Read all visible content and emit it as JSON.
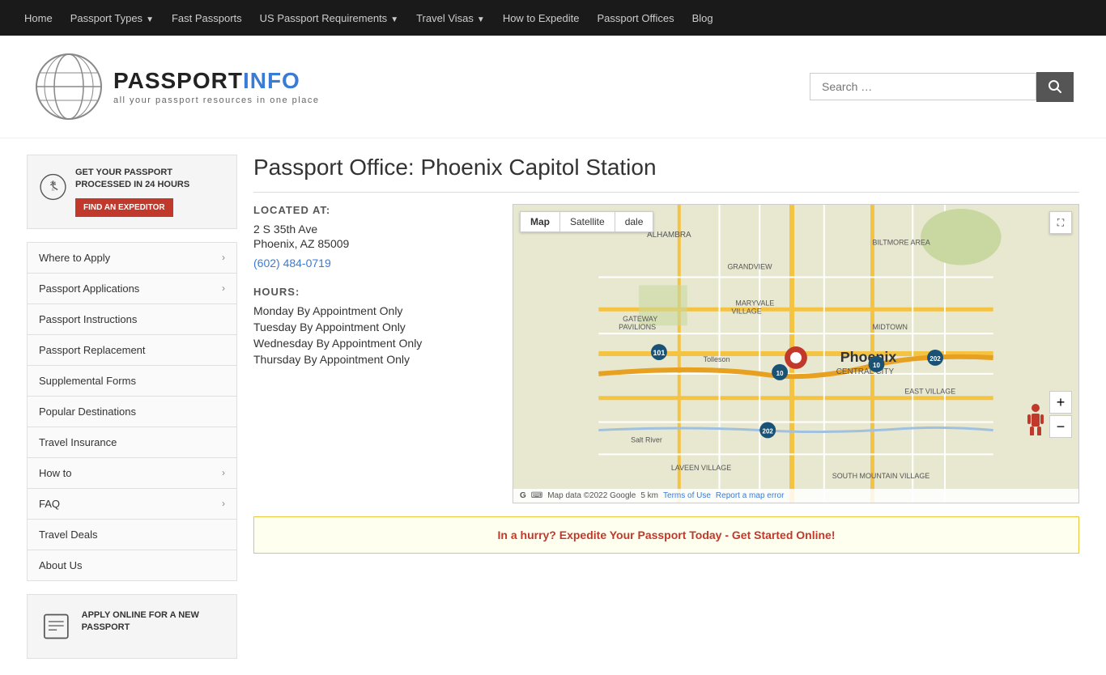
{
  "nav": {
    "items": [
      {
        "label": "Home",
        "hasDropdown": false
      },
      {
        "label": "Passport Types",
        "hasDropdown": true
      },
      {
        "label": "Fast Passports",
        "hasDropdown": false
      },
      {
        "label": "US Passport Requirements",
        "hasDropdown": true
      },
      {
        "label": "Travel Visas",
        "hasDropdown": true
      },
      {
        "label": "How to Expedite",
        "hasDropdown": false
      },
      {
        "label": "Passport Offices",
        "hasDropdown": false
      },
      {
        "label": "Blog",
        "hasDropdown": false
      }
    ]
  },
  "header": {
    "logo_title_plain": "PASSPORT",
    "logo_title_colored": "INFO",
    "logo_subtitle": "all your passport resources in one place",
    "search_placeholder": "Search …"
  },
  "sidebar": {
    "promo1": {
      "icon_label": "24h clock icon",
      "heading": "GET YOUR PASSPORT PROCESSED IN 24 HOURS",
      "button_label": "FIND AN EXPEDITOR"
    },
    "nav_items": [
      {
        "label": "Where to Apply",
        "hasDropdown": true
      },
      {
        "label": "Passport Applications",
        "hasDropdown": true
      },
      {
        "label": "Passport Instructions",
        "hasDropdown": false
      },
      {
        "label": "Passport Replacement",
        "hasDropdown": false
      },
      {
        "label": "Supplemental Forms",
        "hasDropdown": false
      },
      {
        "label": "Popular Destinations",
        "hasDropdown": false
      },
      {
        "label": "Travel Insurance",
        "hasDropdown": false
      },
      {
        "label": "How to",
        "hasDropdown": true
      },
      {
        "label": "FAQ",
        "hasDropdown": true
      },
      {
        "label": "Travel Deals",
        "hasDropdown": false
      },
      {
        "label": "About Us",
        "hasDropdown": false
      }
    ],
    "promo2": {
      "icon_label": "apply online icon",
      "heading": "APPLY ONLINE FOR A NEW PASSPORT"
    }
  },
  "content": {
    "page_title": "Passport Office: Phoenix Capitol Station",
    "location_label": "LOCATED AT:",
    "address_line1": "2 S 35th Ave",
    "address_line2": "Phoenix, AZ 85009",
    "phone": "(602) 484-0719",
    "hours_label": "HOURS:",
    "hours": [
      "Monday By Appointment Only",
      "Tuesday By Appointment Only",
      "Wednesday By Appointment Only",
      "Thursday By Appointment Only"
    ],
    "map_tab_map": "Map",
    "map_tab_satellite": "Satellite",
    "map_tab_scale": "dale",
    "map_footer_data": "Map data ©2022 Google",
    "map_footer_scale": "5 km",
    "map_footer_terms": "Terms of Use",
    "map_footer_report": "Report a map error",
    "expedite_banner": "In a hurry? Expedite Your Passport Today - Get Started Online!"
  }
}
